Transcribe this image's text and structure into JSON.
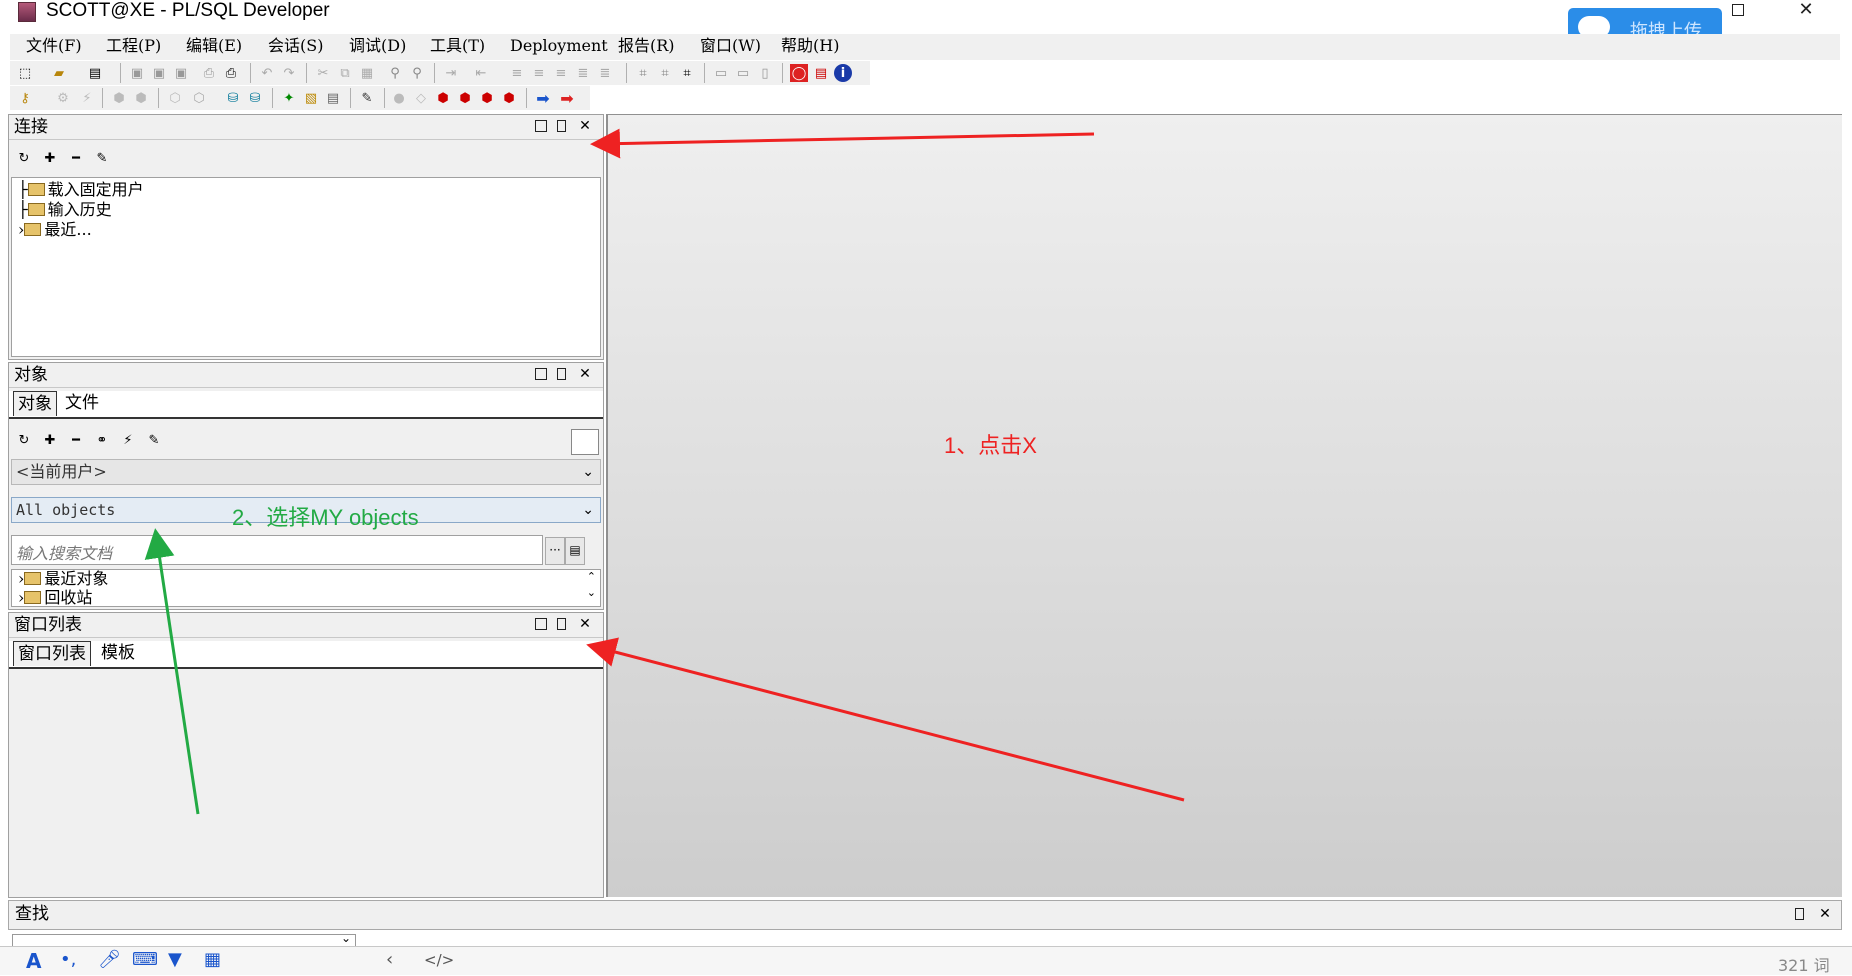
{
  "window": {
    "title": "SCOTT@XE - PL/SQL Developer",
    "upload_label": "拖拽上传"
  },
  "menu": [
    "文件(F)",
    "工程(P)",
    "编辑(E)",
    "会话(S)",
    "调试(D)",
    "工具(T)",
    "Deployment",
    "报告(R)",
    "窗口(W)",
    "帮助(H)"
  ],
  "connection_panel": {
    "title": "连接",
    "items": [
      "载入固定用户",
      "输入历史",
      "最近..."
    ]
  },
  "object_panel": {
    "title": "对象",
    "tabs": [
      "对象",
      "文件"
    ],
    "user_combo": "<当前用户>",
    "filter_combo": "All objects",
    "search_placeholder": "输入搜索文档",
    "items": [
      "最近对象",
      "回收站"
    ]
  },
  "window_list_panel": {
    "title": "窗口列表",
    "tabs": [
      "窗口列表",
      "模板"
    ]
  },
  "find_bar": {
    "title": "查找"
  },
  "annotations": {
    "step1": "1、点击X",
    "step2": "2、选择MY objects",
    "red": "#ee2222",
    "green": "#22aa44"
  },
  "taskbar": {
    "word_count": "321 词"
  }
}
